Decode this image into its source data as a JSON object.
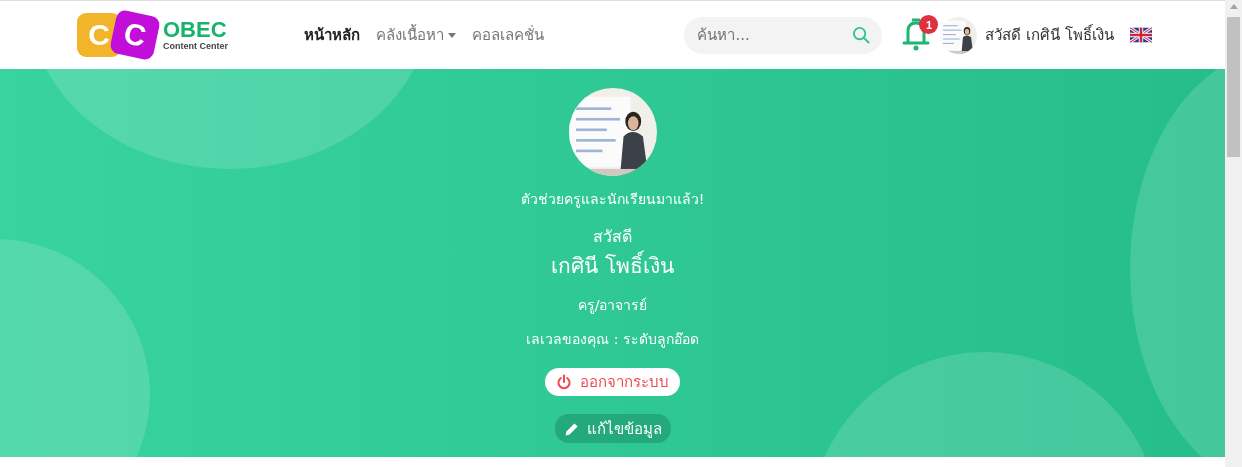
{
  "logo": {
    "letters": [
      "C",
      "C"
    ],
    "title": "OBEC",
    "subtitle": "Content Center"
  },
  "nav": [
    {
      "label": "หน้าหลัก",
      "selected": true,
      "dropdown": false
    },
    {
      "label": "คลังเนื้อหา",
      "selected": false,
      "dropdown": true
    },
    {
      "label": "คอลเลคชั่น",
      "selected": false,
      "dropdown": false
    }
  ],
  "search": {
    "placeholder": "ค้นหา..."
  },
  "notifications": {
    "count": "1"
  },
  "user": {
    "greeting": "สวัสดี เกศินี โพธิ์เงิน"
  },
  "profile": {
    "tagline": "ตัวช่วยครูและนักเรียนมาแล้ว!",
    "hello": "สวัสดี",
    "name": "เกศินี โพธิ์เงิน",
    "role": "ครู/อาจารย์",
    "level": "เลเวลของคุณ : ระดับลูกอ๊อด",
    "logout": "ออกจากระบบ",
    "edit": "แก้ไขข้อมูล"
  }
}
